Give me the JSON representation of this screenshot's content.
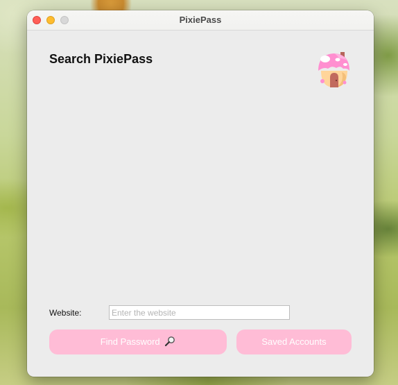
{
  "window": {
    "title": "PixiePass"
  },
  "main": {
    "heading": "Search PixiePass",
    "logo_icon": "mushroom-house-icon"
  },
  "form": {
    "website_label": "Website:",
    "website_placeholder": "Enter the website",
    "website_value": ""
  },
  "buttons": {
    "find_label": "Find Password",
    "find_icon": "magnifying-glass-icon",
    "saved_label": "Saved Accounts"
  },
  "colors": {
    "button_bg": "#ffbcd6",
    "button_text": "#ffffff",
    "window_bg": "#ececec"
  }
}
